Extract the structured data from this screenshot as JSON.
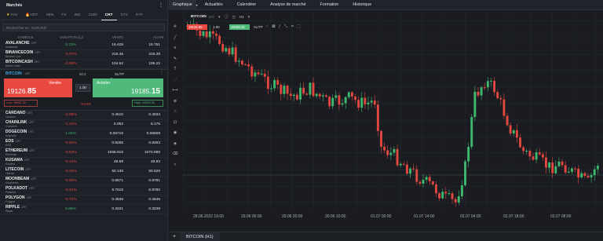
{
  "left_panel": {
    "title": "Marchés",
    "menu_icon": "more-dots",
    "tabs": [
      {
        "label": "FAV",
        "icon": "star-icon"
      },
      {
        "label": "HOT",
        "icon": "fire-icon"
      },
      {
        "label": "SEN"
      },
      {
        "label": "FX"
      },
      {
        "label": "IND"
      },
      {
        "label": "CMD"
      },
      {
        "label": "CRT",
        "active": true
      },
      {
        "label": "STC"
      },
      {
        "label": "ETF"
      }
    ],
    "search_placeholder": "Rechercher ex : EURUSD",
    "columns": {
      "symbol": "SYMBOLE",
      "variation": "VARIATION (1J)",
      "sell": "VENTE",
      "buy": "ACHAT"
    },
    "rows_top": [
      {
        "name": "AVALANCHE",
        "tag": "CRT",
        "sub": "Avalanche",
        "change": "0.72%",
        "dir": "pos",
        "sell": "16.425",
        "buy": "16.751"
      },
      {
        "name": "BINANCECOIN",
        "tag": "CRT",
        "sub": "Binance Coin",
        "change": "-0.37%",
        "dir": "neg",
        "sell": "216.45",
        "buy": "219.39"
      },
      {
        "name": "BITCOINCASH",
        "tag": "CRT",
        "sub": "Bitcoin Cash",
        "change": "-0.96%",
        "dir": "neg",
        "sell": "104.52",
        "buy": "105.22"
      }
    ],
    "selected": {
      "name": "BITCOIN",
      "tag": "CRT",
      "spread": "58.3",
      "sltp": "SL/TP",
      "sell_label": "Vendre",
      "buy_label": "Acheter",
      "sell_price_main": "19126.",
      "sell_price_big": "85",
      "buy_price_main": "19185.",
      "buy_price_big": "15",
      "qty": "1.00",
      "low": "Low: 19061.30",
      "high": "High: 19325.35",
      "change": "-0.42%"
    },
    "rows_bottom": [
      {
        "name": "CARDANO",
        "tag": "CRT",
        "sub": "Cardano",
        "change": "-2.08%",
        "dir": "neg",
        "sell": "0.4510",
        "buy": "0.4534"
      },
      {
        "name": "CHAINLINK",
        "tag": "CRT",
        "sub": "ChainLink",
        "change": "-1.23%",
        "dir": "neg",
        "sell": "6.082",
        "buy": "6.176"
      },
      {
        "name": "DOGECOIN",
        "tag": "CRT",
        "sub": "Dogecoin",
        "change": "1.04%",
        "dir": "pos",
        "sell": "0.06715",
        "buy": "0.06809"
      },
      {
        "name": "EOS",
        "tag": "CRT",
        "sub": "EOS",
        "change": "-0.81%",
        "dir": "neg",
        "sell": "0.9255",
        "buy": "0.9463"
      },
      {
        "name": "ETHEREUM",
        "tag": "CRT",
        "sub": "Ethereum",
        "change": "-0.53%",
        "dir": "neg",
        "sell": "1066.915",
        "buy": "1070.885"
      },
      {
        "name": "KUSAMA",
        "tag": "CRT",
        "sub": "Kusama",
        "change": "-0.12%",
        "dir": "neg",
        "sell": "48.69",
        "buy": "49.93"
      },
      {
        "name": "LITECOIN",
        "tag": "CRT",
        "sub": "Litecoin",
        "change": "-0.32%",
        "dir": "neg",
        "sell": "50.136",
        "buy": "50.626"
      },
      {
        "name": "MOONBEAM",
        "tag": "CRT",
        "sub": "Moonbeam",
        "change": "-0.50%",
        "dir": "neg",
        "sell": "0.6571",
        "buy": "0.6791"
      },
      {
        "name": "POLKADOT",
        "tag": "CRT",
        "sub": "Polkadot",
        "change": "-0.41%",
        "dir": "neg",
        "sell": "6.7615",
        "buy": "6.8780"
      },
      {
        "name": "POLYGON",
        "tag": "CRT",
        "sub": "Polygon",
        "change": "-0.72%",
        "dir": "neg",
        "sell": "0.4535",
        "buy": "0.4645"
      },
      {
        "name": "RIPPLE",
        "tag": "CRT",
        "sub": "Ripple",
        "change": "0.69%",
        "dir": "pos",
        "sell": "0.3221",
        "buy": "0.3239"
      }
    ]
  },
  "topnav": [
    "Graphique",
    "Actualités",
    "Calendrier",
    "Analyse de marché",
    "Formation",
    "Historique"
  ],
  "chart_header": {
    "symbol": "BITCOIN",
    "tag": "CRT",
    "timeframe": "H1"
  },
  "trade_row": {
    "sell": "19126.85",
    "qty": "1.00",
    "buy": "19185.15",
    "sltp": "SL/TP"
  },
  "bottom_tab": "BITCOIN (H1)",
  "chart_data": {
    "type": "candlestick",
    "x_tick_labels": [
      "28.06.2022 16:00",
      "29.06 06:00",
      "29.06 20:00",
      "30.06 10:00",
      "01.07 00:00",
      "01.07 14:00",
      "02.07 04:00",
      "02.07 18:00",
      "03.07 08:00"
    ],
    "colors": {
      "up": "#3fb86f",
      "down": "#e2483f",
      "grid": "#262a31"
    }
  }
}
